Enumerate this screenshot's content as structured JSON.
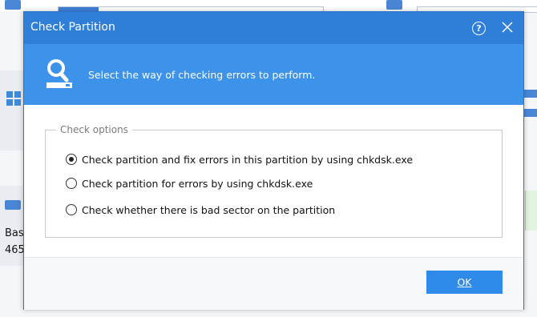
{
  "background": {
    "partial_texts": [
      "Bas",
      "465"
    ]
  },
  "dialog": {
    "title": "Check Partition",
    "help_glyph": "?",
    "banner_text": "Select the way of checking errors to perform.",
    "group_label": "Check options",
    "options": [
      {
        "label": "Check partition and fix errors in this partition by using chkdsk.exe",
        "checked": true
      },
      {
        "label": "Check partition for errors by using chkdsk.exe",
        "checked": false
      },
      {
        "label": "Check whether there is bad sector on the partition",
        "checked": false
      }
    ],
    "ok_label": "OK"
  },
  "colors": {
    "titlebar": "#2f7fd9",
    "banner": "#3d92ea",
    "ok_button": "#2f8bea"
  },
  "icons": [
    "search-disk-icon",
    "help-icon",
    "close-icon",
    "windows-icon",
    "disk-icon"
  ]
}
